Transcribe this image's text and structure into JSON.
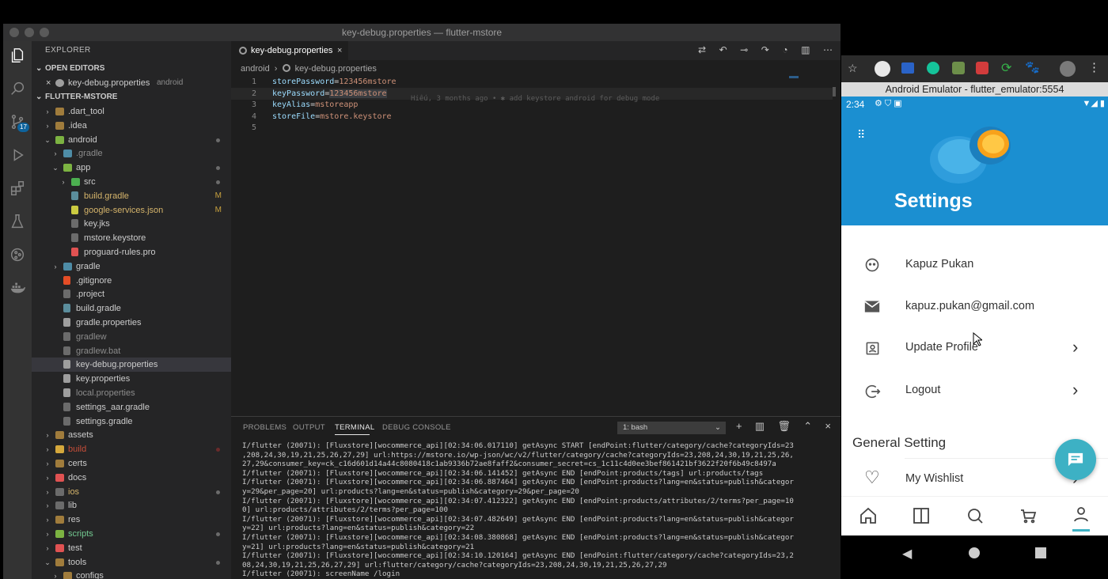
{
  "window": {
    "title": "key-debug.properties — flutter-mstore"
  },
  "activity": {
    "scm_badge": "17"
  },
  "explorer": {
    "header": "EXPLORER",
    "open_editors_label": "OPEN EDITORS",
    "open_editor_file": "key-debug.properties",
    "open_editor_folder": "android",
    "project_label": "FLUTTER-MSTORE",
    "items": [
      {
        "label": "dart_tool",
        "prefix": ".",
        "depth": 1,
        "type": "folder",
        "collapsed": true,
        "color": "#cccccc",
        "icon": "#a07c3c"
      },
      {
        "label": ".idea",
        "depth": 1,
        "type": "folder",
        "collapsed": true,
        "color": "#cccccc",
        "icon": "#a07c3c"
      },
      {
        "label": "android",
        "depth": 1,
        "type": "folder",
        "expanded": true,
        "color": "#cccccc",
        "icon": "#7cb342",
        "dot": true
      },
      {
        "label": ".gradle",
        "depth": 2,
        "type": "folder",
        "collapsed": true,
        "color": "#8c8c8c",
        "icon": "#4e8ca6"
      },
      {
        "label": "app",
        "depth": 2,
        "type": "folder",
        "expanded": true,
        "color": "#cccccc",
        "icon": "#7cb342",
        "dot": true
      },
      {
        "label": "src",
        "depth": 3,
        "type": "folder",
        "collapsed": true,
        "color": "#cccccc",
        "icon": "#4caf50",
        "dot": true
      },
      {
        "label": "build.gradle",
        "depth": 3,
        "type": "file",
        "color": "#d5b46b",
        "icon": "#5b8d9c",
        "mod": "M"
      },
      {
        "label": "google-services.json",
        "depth": 3,
        "type": "file",
        "color": "#d5b46b",
        "icon": "#cbcb41",
        "mod": "M"
      },
      {
        "label": "key.jks",
        "depth": 3,
        "type": "file",
        "color": "#cccccc",
        "icon": "#6b6b6b"
      },
      {
        "label": "mstore.keystore",
        "depth": 3,
        "type": "file",
        "color": "#cccccc",
        "icon": "#6b6b6b"
      },
      {
        "label": "proguard-rules.pro",
        "depth": 3,
        "type": "file",
        "color": "#cccccc",
        "icon": "#e05252"
      },
      {
        "label": "gradle",
        "depth": 2,
        "type": "folder",
        "collapsed": true,
        "color": "#cccccc",
        "icon": "#4e8ca6"
      },
      {
        "label": ".gitignore",
        "depth": 2,
        "type": "file",
        "color": "#cccccc",
        "icon": "#e44d26"
      },
      {
        "label": ".project",
        "depth": 2,
        "type": "file",
        "color": "#cccccc",
        "icon": "#6b6b6b"
      },
      {
        "label": "build.gradle",
        "depth": 2,
        "type": "file",
        "color": "#cccccc",
        "icon": "#5b8d9c"
      },
      {
        "label": "gradle.properties",
        "depth": 2,
        "type": "file",
        "color": "#cccccc",
        "icon": "#9e9e9e"
      },
      {
        "label": "gradlew",
        "depth": 2,
        "type": "file",
        "color": "#8c8c8c",
        "icon": "#6b6b6b"
      },
      {
        "label": "gradlew.bat",
        "depth": 2,
        "type": "file",
        "color": "#8c8c8c",
        "icon": "#6b6b6b"
      },
      {
        "label": "key-debug.properties",
        "depth": 2,
        "type": "file",
        "color": "#cccccc",
        "icon": "#9e9e9e",
        "selected": true
      },
      {
        "label": "key.properties",
        "depth": 2,
        "type": "file",
        "color": "#cccccc",
        "icon": "#9e9e9e"
      },
      {
        "label": "local.properties",
        "depth": 2,
        "type": "file",
        "color": "#8c8c8c",
        "icon": "#9e9e9e"
      },
      {
        "label": "settings_aar.gradle",
        "depth": 2,
        "type": "file",
        "color": "#cccccc",
        "icon": "#6b6b6b"
      },
      {
        "label": "settings.gradle",
        "depth": 2,
        "type": "file",
        "color": "#cccccc",
        "icon": "#6b6b6b"
      },
      {
        "label": "assets",
        "depth": 1,
        "type": "folder",
        "collapsed": true,
        "color": "#cccccc",
        "icon": "#a07c3c"
      },
      {
        "label": "build",
        "depth": 1,
        "type": "folder",
        "collapsed": true,
        "color": "#c74e39",
        "icon": "#d5a83c",
        "dot": true,
        "dotColor": "#6b2b2b"
      },
      {
        "label": "certs",
        "depth": 1,
        "type": "folder",
        "collapsed": true,
        "color": "#cccccc",
        "icon": "#a07c3c"
      },
      {
        "label": "docs",
        "depth": 1,
        "type": "folder",
        "collapsed": true,
        "color": "#cccccc",
        "icon": "#e05252"
      },
      {
        "label": "ios",
        "depth": 1,
        "type": "folder",
        "collapsed": true,
        "color": "#d5b46b",
        "icon": "#6b6b6b",
        "dot": true
      },
      {
        "label": "lib",
        "depth": 1,
        "type": "folder",
        "collapsed": true,
        "color": "#cccccc",
        "icon": "#6b6b6b"
      },
      {
        "label": "res",
        "depth": 1,
        "type": "folder",
        "collapsed": true,
        "color": "#cccccc",
        "icon": "#a07c3c"
      },
      {
        "label": "scripts",
        "depth": 1,
        "type": "folder",
        "collapsed": true,
        "color": "#73c991",
        "icon": "#7cb342",
        "dot": true
      },
      {
        "label": "test",
        "depth": 1,
        "type": "folder",
        "collapsed": true,
        "color": "#cccccc",
        "icon": "#e05252"
      },
      {
        "label": "tools",
        "depth": 1,
        "type": "folder",
        "expanded": true,
        "color": "#cccccc",
        "icon": "#a07c3c",
        "dot": true
      },
      {
        "label": "configs",
        "depth": 2,
        "type": "folder",
        "collapsed": true,
        "color": "#cccccc",
        "icon": "#a07c3c"
      }
    ]
  },
  "editor": {
    "tab_label": "key-debug.properties",
    "breadcrumb_folder": "android",
    "breadcrumb_file": "key-debug.properties",
    "lines": [
      {
        "n": "1",
        "key": "storePassword",
        "val": "123456mstore"
      },
      {
        "n": "2",
        "key": "keyPassword",
        "val": "123456mstore"
      },
      {
        "n": "3",
        "key": "keyAlias",
        "val": "mstoreapp"
      },
      {
        "n": "4",
        "key": "storeFile",
        "val": "mstore.keystore"
      },
      {
        "n": "5",
        "key": "",
        "val": ""
      }
    ],
    "blame": "Hiếu, 3 months ago • ✱ add keystore android for debug mode"
  },
  "panel": {
    "tabs": [
      "PROBLEMS",
      "OUTPUT",
      "TERMINAL",
      "DEBUG CONSOLE"
    ],
    "active_tab": "TERMINAL",
    "terminal_select": "1: bash",
    "lines": [
      "I/flutter (20071): [Fluxstore][wocommerce_api][02:34:06.017110] getAsync START [endPoint:flutter/category/cache?categoryIds=23",
      ",208,24,30,19,21,25,26,27,29] url:https://mstore.io/wp-json/wc/v2/flutter/category/cache?categoryIds=23,208,24,30,19,21,25,26,",
      "27,29&consumer_key=ck_c16d601d14a44c8080418c1ab9336b72ae8faff2&consumer_secret=cs_1c11c4d0ee3bef861421bf3622f20f6b49c8497a",
      "I/flutter (20071): [Fluxstore][wocommerce_api][02:34:06.141452] getAsync END [endPoint:products/tags] url:products/tags",
      "I/flutter (20071): [Fluxstore][wocommerce_api][02:34:06.887464] getAsync END [endPoint:products?lang=en&status=publish&categor",
      "y=29&per_page=20] url:products?lang=en&status=publish&category=29&per_page=20",
      "I/flutter (20071): [Fluxstore][wocommerce_api][02:34:07.412322] getAsync END [endPoint:products/attributes/2/terms?per_page=10",
      "0] url:products/attributes/2/terms?per_page=100",
      "I/flutter (20071): [Fluxstore][wocommerce_api][02:34:07.482649] getAsync END [endPoint:products?lang=en&status=publish&categor",
      "y=22] url:products?lang=en&status=publish&category=22",
      "I/flutter (20071): [Fluxstore][wocommerce_api][02:34:08.380868] getAsync END [endPoint:products?lang=en&status=publish&categor",
      "y=21] url:products?lang=en&status=publish&category=21",
      "I/flutter (20071): [Fluxstore][wocommerce_api][02:34:10.120164] getAsync END [endPoint:flutter/category/cache?categoryIds=23,2",
      "08,24,30,19,21,25,26,27,29] url:flutter/category/cache?categoryIds=23,208,24,30,19,21,25,26,27,29",
      "I/flutter (20071): screenName /login"
    ]
  },
  "emulator": {
    "title": "Android Emulator - flutter_emulator:5554",
    "status_time": "2:34",
    "screen_title": "Settings",
    "user_name": "Kapuz Pukan",
    "user_email": "kapuz.pukan@gmail.com",
    "update_profile": "Update Profile",
    "logout": "Logout",
    "general_setting": "General Setting",
    "wishlist": "My Wishlist",
    "accent": "#1b8fd1",
    "fab_color": "#3db1c4"
  }
}
